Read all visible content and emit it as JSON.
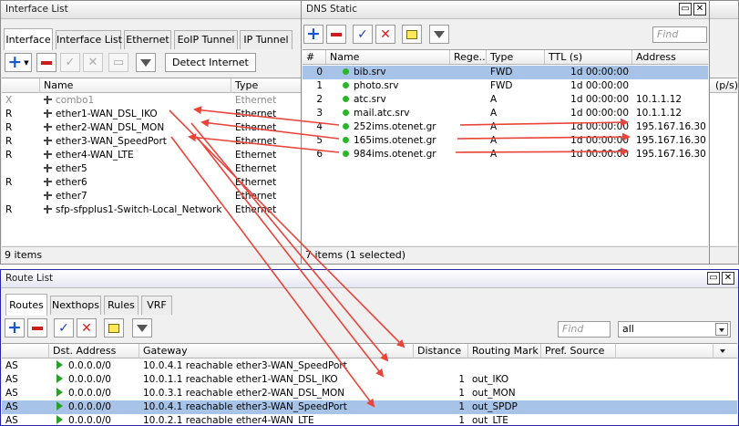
{
  "interface_window": {
    "title": "Interface List",
    "tabs": [
      "Interface",
      "Interface List",
      "Ethernet",
      "EoIP Tunnel",
      "IP Tunnel"
    ],
    "detect_label": "Detect Internet",
    "columns": [
      "Name",
      "Type"
    ],
    "rows": [
      {
        "flag": "X",
        "name": "combo1",
        "type": "Ethernet",
        "disabled": true
      },
      {
        "flag": "R",
        "name": "ether1-WAN_DSL_IKO",
        "type": "Ethernet"
      },
      {
        "flag": "R",
        "name": "ether2-WAN_DSL_MON",
        "type": "Ethernet"
      },
      {
        "flag": "R",
        "name": "ether3-WAN_SpeedPort",
        "type": "Ethernet"
      },
      {
        "flag": "R",
        "name": "ether4-WAN_LTE",
        "type": "Ethernet"
      },
      {
        "flag": "",
        "name": "ether5",
        "type": "Ethernet"
      },
      {
        "flag": "R",
        "name": "ether6",
        "type": "Ethernet"
      },
      {
        "flag": "",
        "name": "ether7",
        "type": "Ethernet"
      },
      {
        "flag": "R",
        "name": "sfp-sfpplus1-Switch-Local_Network",
        "type": "Ethernet"
      }
    ],
    "extra_column": "(p/s)",
    "status": "9 items"
  },
  "dns_window": {
    "title": "DNS Static",
    "find_placeholder": "Find",
    "columns": [
      "#",
      "Name",
      "Rege...",
      "Type",
      "TTL (s)",
      "Address"
    ],
    "rows": [
      {
        "num": "0",
        "name": "bib.srv",
        "type": "FWD",
        "ttl": "1d 00:00:00",
        "address": "",
        "selected": true
      },
      {
        "num": "1",
        "name": "photo.srv",
        "type": "FWD",
        "ttl": "1d 00:00:00",
        "address": ""
      },
      {
        "num": "2",
        "name": "atc.srv",
        "type": "A",
        "ttl": "1d 00:00:00",
        "address": "10.1.1.12"
      },
      {
        "num": "3",
        "name": "mail.atc.srv",
        "type": "A",
        "ttl": "1d 00:00:00",
        "address": "10.1.1.12"
      },
      {
        "num": "4",
        "name": "252ims.otenet.gr",
        "type": "A",
        "ttl": "1d 00:00:00",
        "address": "195.167.16.30"
      },
      {
        "num": "5",
        "name": "165ims.otenet.gr",
        "type": "A",
        "ttl": "1d 00:00:00",
        "address": "195.167.16.30"
      },
      {
        "num": "6",
        "name": "984ims.otenet.gr",
        "type": "A",
        "ttl": "1d 00:00:00",
        "address": "195.167.16.30"
      }
    ],
    "status": "7 items (1 selected)"
  },
  "route_window": {
    "title": "Route List",
    "tabs": [
      "Routes",
      "Nexthops",
      "Rules",
      "VRF"
    ],
    "find_placeholder": "Find",
    "filter_value": "all",
    "columns": [
      "Dst. Address",
      "Gateway",
      "Distance",
      "Routing Mark",
      "Pref. Source"
    ],
    "rows": [
      {
        "flag": "AS",
        "dst": "0.0.0.0/0",
        "gateway": "10.0.4.1 reachable ether3-WAN_SpeedPort",
        "distance": "",
        "mark": ""
      },
      {
        "flag": "AS",
        "dst": "0.0.0.0/0",
        "gateway": "10.0.1.1 reachable ether1-WAN_DSL_IKO",
        "distance": "1",
        "mark": "out_IKO"
      },
      {
        "flag": "AS",
        "dst": "0.0.0.0/0",
        "gateway": "10.0.3.1 reachable ether2-WAN_DSL_MON",
        "distance": "1",
        "mark": "out_MON"
      },
      {
        "flag": "AS",
        "dst": "0.0.0.0/0",
        "gateway": "10.0.4.1 reachable ether3-WAN_SpeedPort",
        "distance": "1",
        "mark": "out_SPDP",
        "selected": true
      },
      {
        "flag": "AS",
        "dst": "0.0.0.0/0",
        "gateway": "10.0.2.1 reachable ether4-WAN_LTE",
        "distance": "1",
        "mark": "out_LTE"
      }
    ]
  },
  "colors": {
    "arrow": "#e8443a",
    "selected_row": "#a7c4e8",
    "route_title_bar": "#2626a8"
  }
}
